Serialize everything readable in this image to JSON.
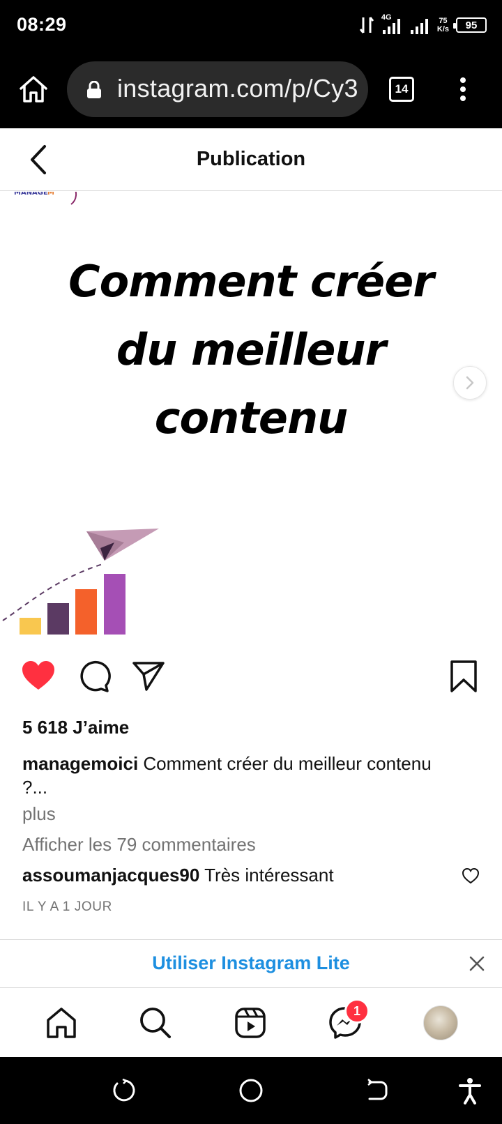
{
  "status_bar": {
    "time": "08:29",
    "network": "4G",
    "speed_value": "75",
    "speed_unit": "K/s",
    "battery": "95"
  },
  "browser": {
    "url": "instagram.com/p/Cy3",
    "tab_count": "14"
  },
  "header": {
    "title": "Publication"
  },
  "post": {
    "headline_lines": [
      "Comment créer",
      "du meilleur",
      "contenu"
    ],
    "likes": "5 618 J’aime",
    "author": "managemoici",
    "caption_text": " Comment créer du meilleur contenu",
    "caption_continuation": "?...",
    "more_label": "plus",
    "view_comments": "Afficher les 79 commentaires",
    "top_comment": {
      "user": "assoumanjacques90",
      "text": " Très intéressant"
    },
    "timestamp": "IL Y A 1 JOUR"
  },
  "lite_banner": {
    "link_label": "Utiliser Instagram Lite"
  },
  "bottom_nav": {
    "messages_badge": "1"
  },
  "colors": {
    "like_red": "#ff3040",
    "link_blue": "#1d8fe0",
    "muted_gray": "#737373"
  }
}
